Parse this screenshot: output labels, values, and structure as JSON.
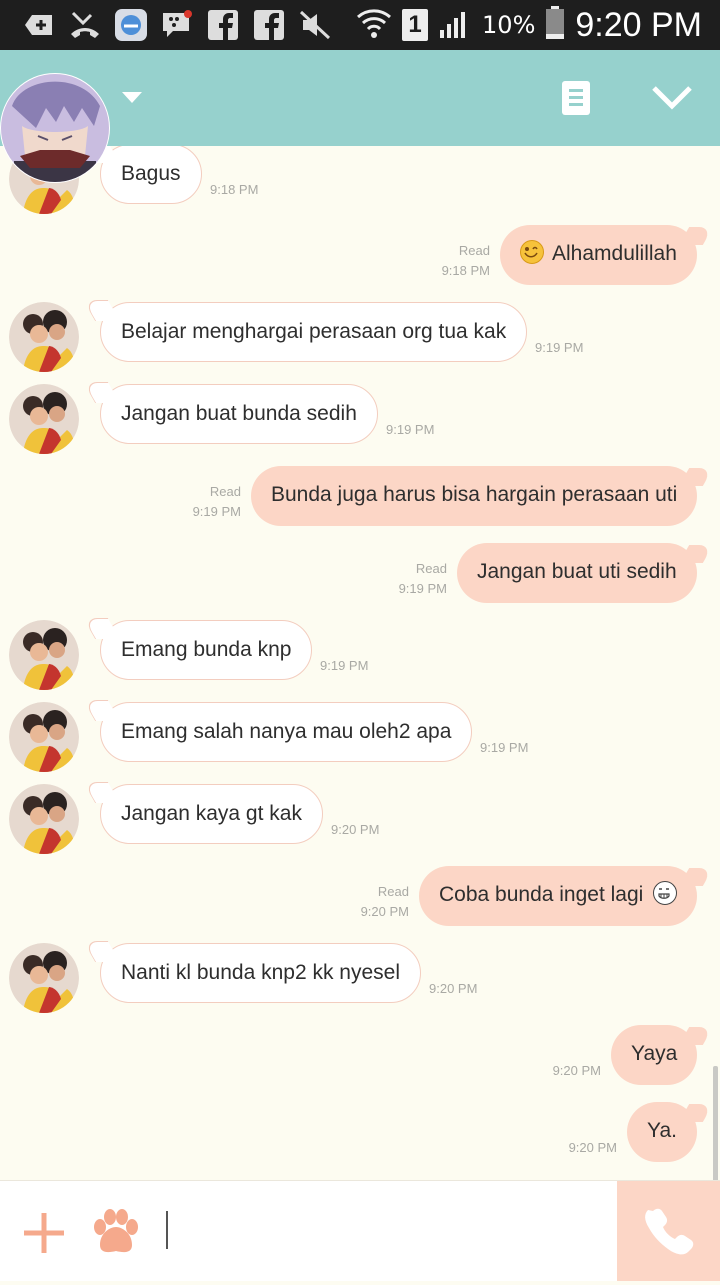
{
  "status_bar": {
    "signal_label": "1",
    "battery": "10%",
    "time": "9:20 PM"
  },
  "header": {
    "dropdown_icon": "caret-down-icon",
    "notes_icon": "notes-icon",
    "collapse_icon": "chevron-down-icon"
  },
  "messages": [
    {
      "dir": "in",
      "text": "Bagus",
      "time": "9:18 PM"
    },
    {
      "dir": "out",
      "text": "Alhamdulillah",
      "time": "9:18 PM",
      "read": "Read",
      "emoji": "smile"
    },
    {
      "dir": "in",
      "text": "Belajar menghargai perasaan org tua kak",
      "time": "9:19 PM"
    },
    {
      "dir": "in",
      "text": "Jangan buat bunda sedih",
      "time": "9:19 PM"
    },
    {
      "dir": "out",
      "text": "Bunda juga harus bisa hargain perasaan uti",
      "time": "9:19 PM",
      "read": "Read"
    },
    {
      "dir": "out",
      "text": "Jangan buat uti sedih",
      "time": "9:19 PM",
      "read": "Read"
    },
    {
      "dir": "in",
      "text": "Emang bunda knp",
      "time": "9:19 PM"
    },
    {
      "dir": "in",
      "text": "Emang salah nanya mau oleh2 apa",
      "time": "9:19 PM"
    },
    {
      "dir": "in",
      "text": "Jangan kaya gt kak",
      "time": "9:20 PM"
    },
    {
      "dir": "out",
      "text": "Coba bunda inget lagi",
      "time": "9:20 PM",
      "read": "Read",
      "emoji": "grin"
    },
    {
      "dir": "in",
      "text": "Nanti kl bunda knp2 kk nyesel",
      "time": "9:20 PM"
    },
    {
      "dir": "out",
      "text": "Yaya",
      "time": "9:20 PM"
    },
    {
      "dir": "out",
      "text": "Ya.",
      "time": "9:20 PM"
    }
  ],
  "composer": {
    "add_icon": "plus-icon",
    "sticker_icon": "paw-icon",
    "call_icon": "phone-icon",
    "input_value": ""
  },
  "colors": {
    "header": "#96d1cd",
    "background": "#fdfcf1",
    "outgoing_bubble": "#fcd6c6",
    "incoming_border": "#f3cdbf",
    "accent": "#f5a98c"
  }
}
